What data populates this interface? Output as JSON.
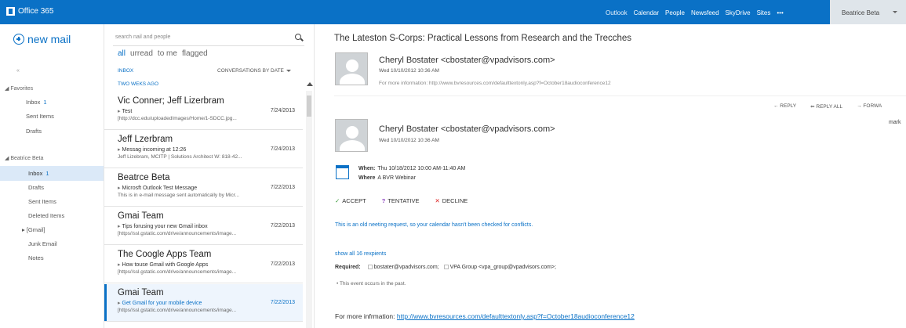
{
  "topbar": {
    "brand": "Office 365",
    "nav": [
      "Outlook",
      "Calendar",
      "People",
      "Newsfeed",
      "SkyDrive",
      "Sites",
      "•••"
    ],
    "user": "Beatrice Beta"
  },
  "leftnav": {
    "new_mail": "new mail",
    "favorites_head": "◢ Favorites",
    "fav_inbox": "Inbox",
    "fav_inbox_count": "1",
    "fav_sent": "Sent Items",
    "fav_drafts": "Drafts",
    "account_head": "◢ Beatrice Beta",
    "inbox": "Inbox",
    "inbox_count": "1",
    "drafts": "Drafts",
    "sent": "Sent Items",
    "deleted": "Deleted Items",
    "gmail": "▸ [Gmail]",
    "junk": "Junk Email",
    "notes": "Notes"
  },
  "list": {
    "search_placeholder": "search nail and people",
    "filters": [
      "all",
      "urread",
      "to me",
      "flagged"
    ],
    "inbox_label": "INBOX",
    "sort_label": "CONVERSATIONS BY DATE",
    "group_label": "TWO WEKS AGO",
    "messages": [
      {
        "from": "Vic Conner; Jeff Lizerbram",
        "subject": "Test",
        "date": "7/24/2013",
        "preview": "[http://dcc.edu/uploadedImages/Home/1-SDCC.jpg..."
      },
      {
        "from": "Jeff Lzerbram",
        "subject": "Messag incoming at 12:26",
        "date": "7/24/2013",
        "preview": "Jeff Lizebram, MCITP | Solutions Architect W: 818-42..."
      },
      {
        "from": "Beatrce Beta",
        "subject": "Microsft Outlook Test Message",
        "date": "7/22/2013",
        "preview": "This is in e-mail message sent automatically by Micr..."
      },
      {
        "from": "Gmai Team",
        "subject": "Tips forusing your new Gmail inbox",
        "date": "7/22/2013",
        "preview": "[https//ssl.gstatic.com/drive/announcements/image..."
      },
      {
        "from": "The Coogle Apps Team",
        "subject": "How touse Gmail with Google Apps",
        "date": "7/22/2013",
        "preview": "[https//ssl.gstatic.com/drive/announcements/image..."
      },
      {
        "from": "Gmai Team",
        "subject": "Get Gmail for your mobile device",
        "date": "7/22/2013",
        "preview": "[https//ssl.gstatic.com/drive/announcements/image..."
      }
    ]
  },
  "pane": {
    "title": "The Lateston S-Corps: Practical Lessons from Research and the Trecches",
    "sender1": "Cheryl Bostater <cbostater@vpadvisors.com>",
    "date1": "Wed 10/10/2012 10:36 AM",
    "more1": "For more information: http://www.bvresources.com/defaulttextonly.asp?f=October18audioconference12",
    "actions": [
      "← REPLY",
      "⇚ REPLY ALL",
      "→ FORWA"
    ],
    "mark": "mark",
    "sender2": "Cheryl Bostater <cbostater@vpadvisors.com>",
    "date2": "Wed 10/10/2012 10:36 AM",
    "when_label": "When:",
    "when_value": "Thu 10/18/2012 10:00 AM-11:40 AM",
    "where_label": "Where",
    "where_value": "A BVR Webinar",
    "accept": "ACCEPT",
    "tentative": "TENTATIVE",
    "decline": "DECLINE",
    "notice": "This is an old neeting request, so your calendar hasn't been checked for conflicts.",
    "show_all": "show all 16 rexpients",
    "required_label": "Required:",
    "req1": "bostater@vpadvisors.com;",
    "req2": "VPA Group <vpa_group@vpadvisors.com>;",
    "past": "• This event occurs in the past.",
    "moreinfo_label": "For more infrmation:",
    "moreinfo_link": "http://www.bvresources.com/defaulttextonly.asp?f=October18audioconference12"
  },
  "colors": {
    "accent": "#0a71c6",
    "topbar": "#0a71c6",
    "selected": "#dbe9f8"
  }
}
